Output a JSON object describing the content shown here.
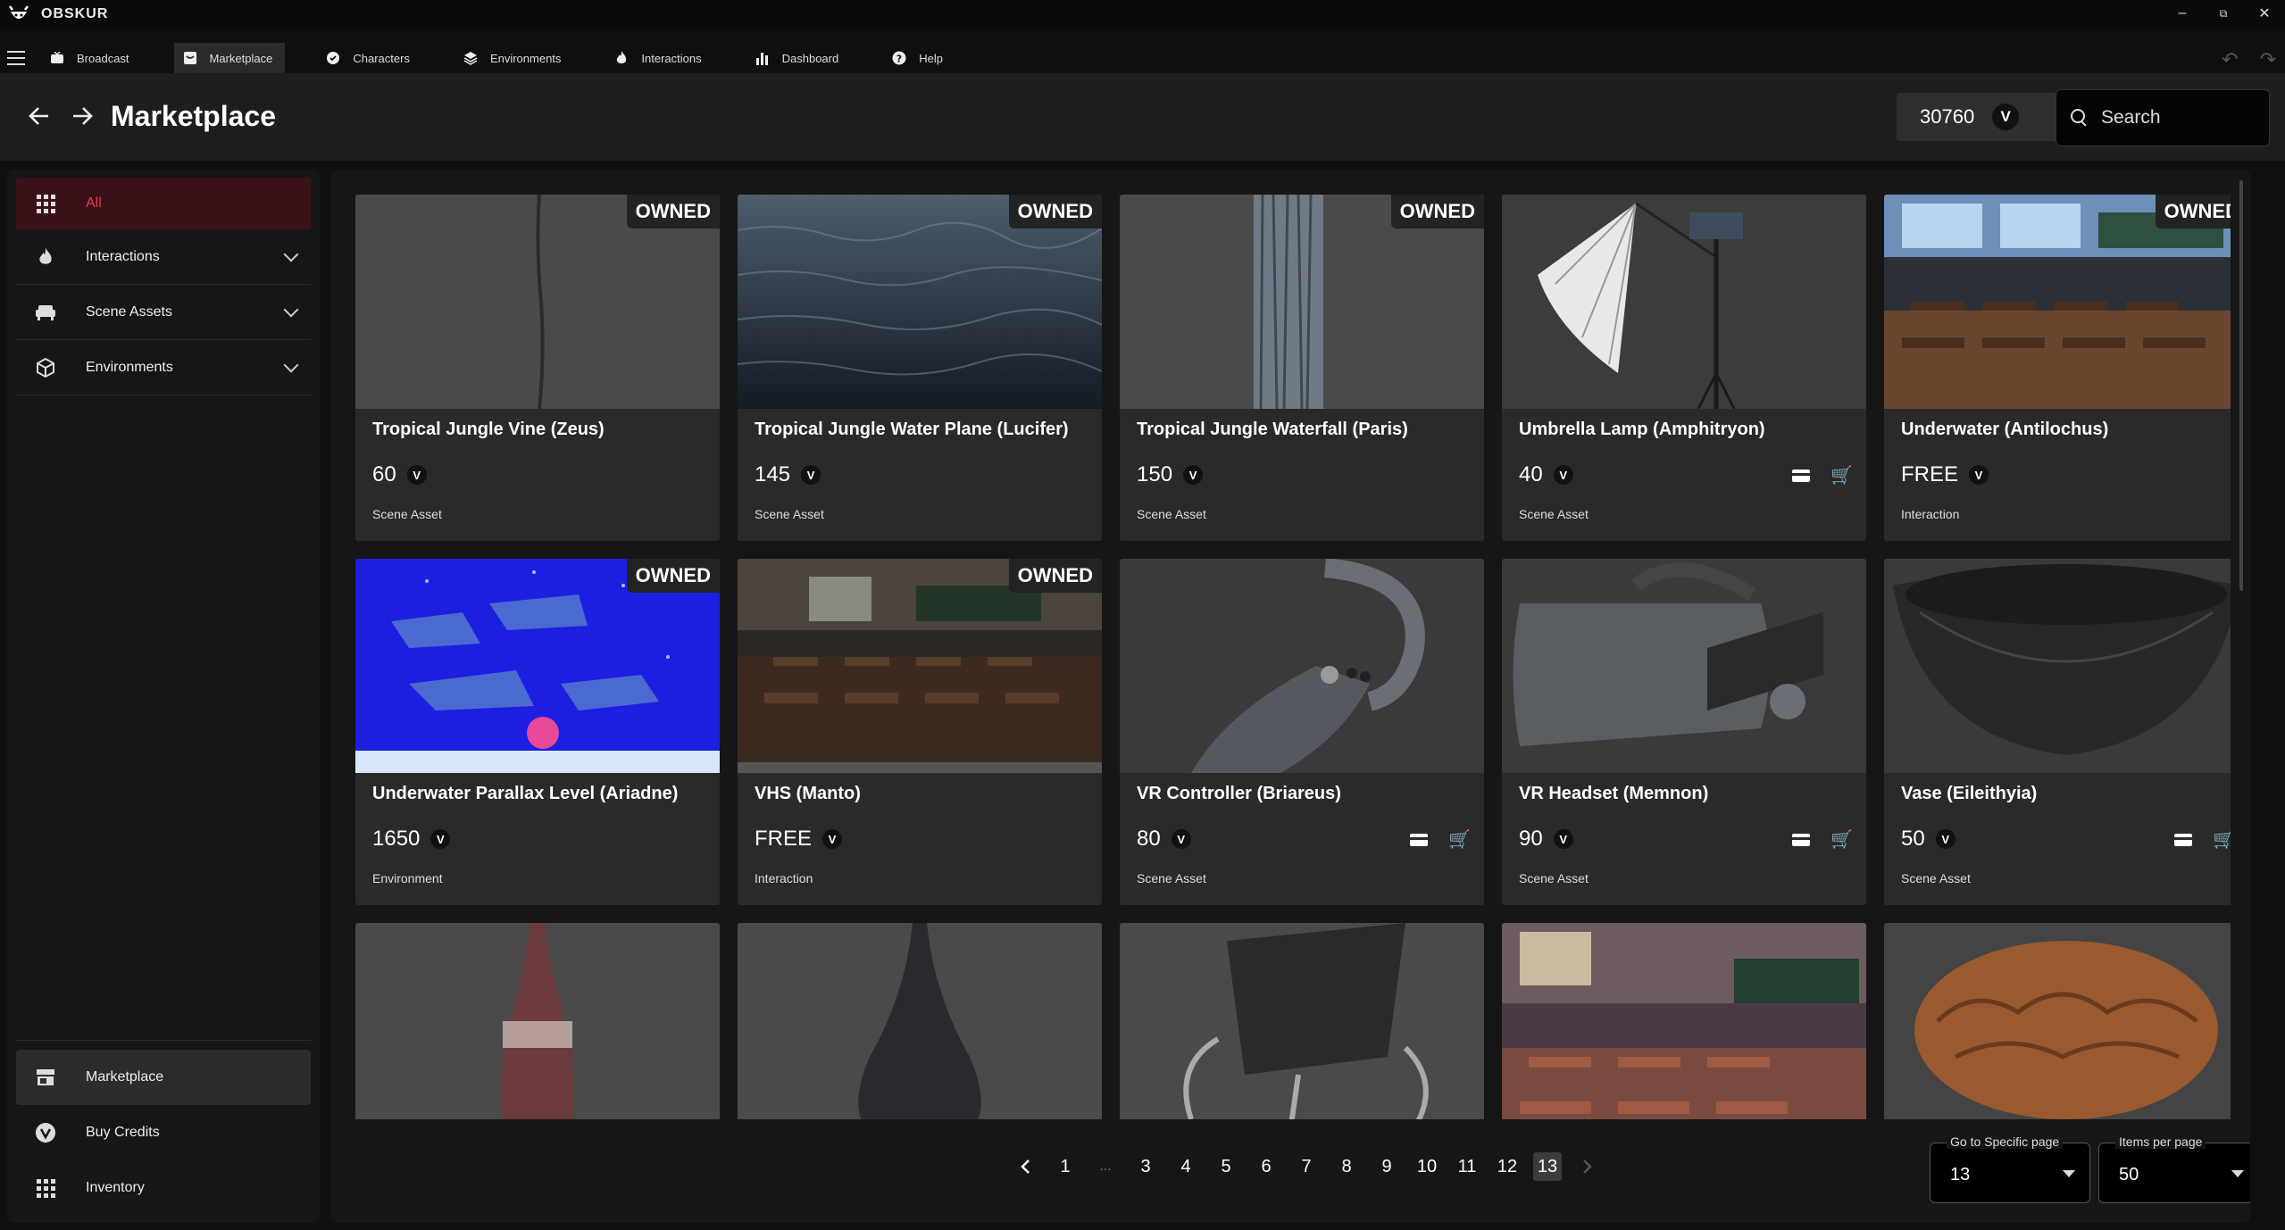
{
  "app": {
    "name": "OBSKUR"
  },
  "window_controls": {
    "minimize": "–",
    "restore": "⧉",
    "close": "✕"
  },
  "tabs": [
    {
      "label": "Broadcast",
      "icon": "broadcast-icon",
      "active": false
    },
    {
      "label": "Marketplace",
      "icon": "store-icon",
      "active": true
    },
    {
      "label": "Characters",
      "icon": "characters-icon",
      "active": false
    },
    {
      "label": "Environments",
      "icon": "layers-icon",
      "active": false
    },
    {
      "label": "Interactions",
      "icon": "flame-icon",
      "active": false
    },
    {
      "label": "Dashboard",
      "icon": "bar-chart-icon",
      "active": false
    },
    {
      "label": "Help",
      "icon": "help-icon",
      "active": false
    }
  ],
  "header": {
    "title": "Marketplace",
    "credits": "30760",
    "credit_symbol": "V",
    "search_placeholder": "Search"
  },
  "sidebar": {
    "items": [
      {
        "label": "All",
        "icon": "grid-icon"
      },
      {
        "label": "Interactions",
        "icon": "flame-icon"
      },
      {
        "label": "Scene Assets",
        "icon": "sofa-icon"
      },
      {
        "label": "Environments",
        "icon": "cube-icon"
      }
    ],
    "bottom": [
      {
        "label": "Marketplace",
        "icon": "store-icon"
      },
      {
        "label": "Buy Credits",
        "icon": "credits-icon"
      },
      {
        "label": "Inventory",
        "icon": "grid-icon"
      }
    ]
  },
  "owned_label": "OWNED",
  "products": [
    {
      "title": "Tropical Jungle Vine (Zeus)",
      "price": "60",
      "type": "Scene Asset",
      "owned": true
    },
    {
      "title": "Tropical Jungle Water Plane (Lucifer)",
      "price": "145",
      "type": "Scene Asset",
      "owned": true
    },
    {
      "title": "Tropical Jungle Waterfall (Paris)",
      "price": "150",
      "type": "Scene Asset",
      "owned": true
    },
    {
      "title": "Umbrella Lamp (Amphitryon)",
      "price": "40",
      "type": "Scene Asset",
      "owned": false
    },
    {
      "title": "Underwater (Antilochus)",
      "price": "FREE",
      "type": "Interaction",
      "owned": true
    },
    {
      "title": "Underwater Parallax Level (Ariadne)",
      "price": "1650",
      "type": "Environment",
      "owned": true
    },
    {
      "title": "VHS (Manto)",
      "price": "FREE",
      "type": "Interaction",
      "owned": true
    },
    {
      "title": "VR Controller (Briareus)",
      "price": "80",
      "type": "Scene Asset",
      "owned": false
    },
    {
      "title": "VR Headset (Memnon)",
      "price": "90",
      "type": "Scene Asset",
      "owned": false
    },
    {
      "title": "Vase (Eileithyia)",
      "price": "50",
      "type": "Scene Asset",
      "owned": false
    }
  ],
  "pagination": {
    "prev": "‹",
    "next": "›",
    "pages": [
      "1",
      "...",
      "3",
      "4",
      "5",
      "6",
      "7",
      "8",
      "9",
      "10",
      "11",
      "12",
      "13"
    ],
    "current": "13",
    "goto_label": "Go to Specific page",
    "goto_value": "13",
    "per_page_label": "Items per page",
    "per_page_value": "50"
  }
}
